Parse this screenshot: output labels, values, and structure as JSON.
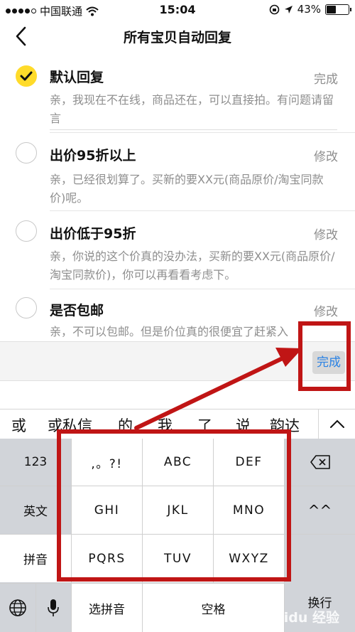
{
  "status_bar": {
    "carrier": "中国联通",
    "time": "15:04",
    "battery": "43%",
    "battery_level": 0.43
  },
  "nav": {
    "title": "所有宝贝自动回复"
  },
  "replies": [
    {
      "name": "默认回复",
      "action": "完成",
      "checked": true,
      "text": "亲，我现在不在线，商品还在，可以直接拍。有问题请留言"
    },
    {
      "name": "出价95折以上",
      "action": "修改",
      "checked": false,
      "text": "亲，已经很划算了。买新的要XX元(商品原价/淘宝同款价)呢。"
    },
    {
      "name": "出价低于95折",
      "action": "修改",
      "checked": false,
      "text": "亲，你说的这个价真的没办法，买新的要XX元(商品原价/淘宝同款价)，你可以再看看考虑下。"
    },
    {
      "name": "是否包邮",
      "action": "修改",
      "checked": false,
      "text": "亲，不可以包邮。但是价位真的很便宜了赶紧入"
    }
  ],
  "input_bar": {
    "done_label": "完成"
  },
  "candidates": [
    "或",
    "或私信",
    "的",
    "我",
    "了",
    "说",
    "韵达"
  ],
  "keyboard": {
    "left": [
      "123",
      "英文",
      "拼音"
    ],
    "keys": [
      ",。?!",
      "ABC",
      "DEF",
      "GHI",
      "JKL",
      "MNO",
      "PQRS",
      "TUV",
      "WXYZ"
    ],
    "emoticon": "^^",
    "return": "换行",
    "select_pinyin": "选拼音",
    "space": "空格"
  },
  "watermark": "Baidu 经验",
  "colors": {
    "accent_yellow": "#ffdb2a",
    "link_blue": "#2a82e4",
    "annotation_red": "#c01515"
  }
}
